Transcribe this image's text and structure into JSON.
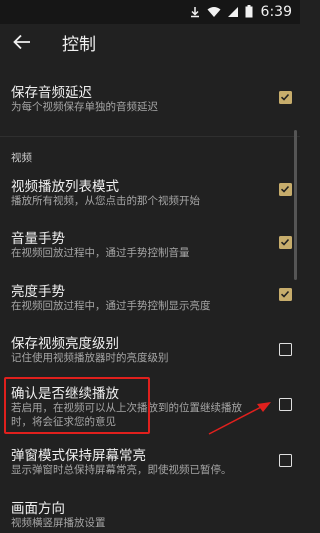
{
  "status_bar": {
    "time": "6:39",
    "icons": [
      "download-icon",
      "wifi-icon",
      "signal-icon",
      "battery-icon"
    ]
  },
  "app_bar": {
    "back_icon": "arrow-back-icon",
    "title": "控制"
  },
  "settings": [
    {
      "id": "save-audio-delay",
      "title": "保存音频延迟",
      "summary": "为每个视频保存单独的音频延迟",
      "checked": true
    },
    {
      "id": "video-playlist-mode",
      "title": "视频播放列表模式",
      "summary": "播放所有视频，从您点击的那个视频开始",
      "checked": true
    },
    {
      "id": "volume-gesture",
      "title": "音量手势",
      "summary": "在视频回放过程中，通过手势控制音量",
      "checked": true
    },
    {
      "id": "brightness-gesture",
      "title": "亮度手势",
      "summary": "在视频回放过程中，通过手势控制显示亮度",
      "checked": true
    },
    {
      "id": "save-brightness-level",
      "title": "保存视频亮度级别",
      "summary": "记住使用视频播放器时的亮度级别",
      "checked": false
    },
    {
      "id": "confirm-resume",
      "title": "确认是否继续播放",
      "summary_line1": "若启用，在视频可以从上次播放到的位置继续播放",
      "summary_line2": "时，将会征求您的意见",
      "checked": false
    },
    {
      "id": "popup-keep-screen-on",
      "title": "弹窗模式保持屏幕常亮",
      "summary": "显示弹窗时总保持屏幕常亮，即使视频已暂停。",
      "checked": false
    },
    {
      "id": "screen-orientation",
      "title": "画面方向",
      "summary": "视频横竖屏播放设置"
    }
  ],
  "category": {
    "label": "视频"
  },
  "colors": {
    "background": "#212121",
    "accent": "#c7ad6c",
    "highlight": "#e0201d"
  }
}
